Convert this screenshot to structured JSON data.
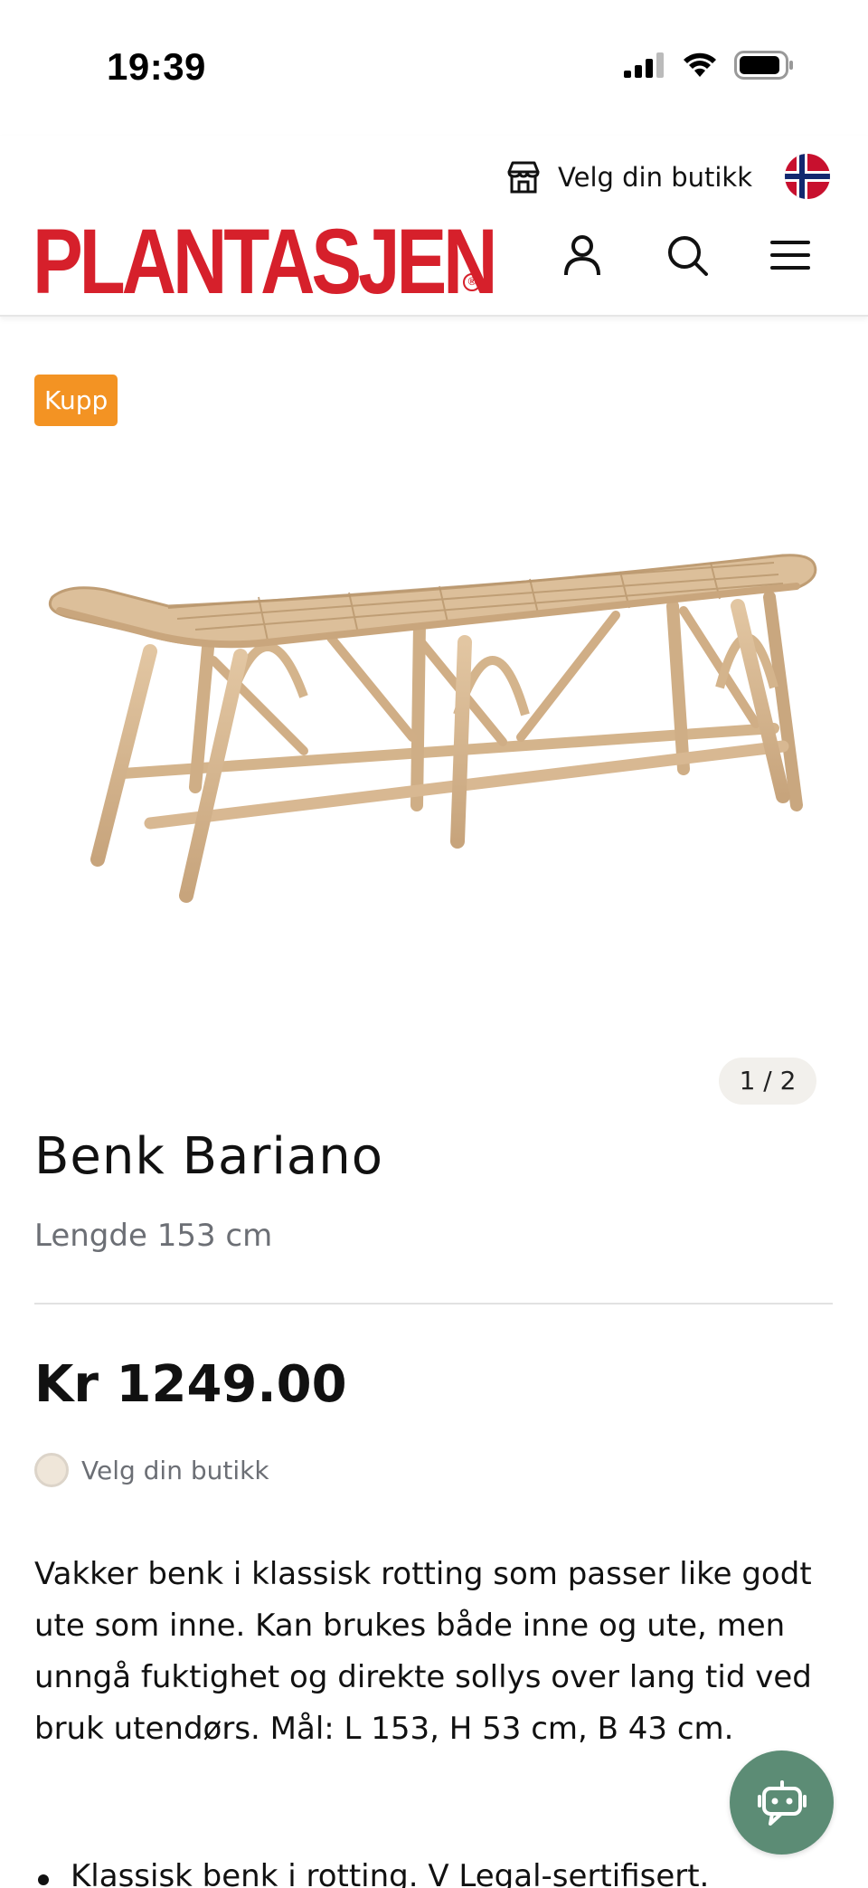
{
  "status_bar": {
    "time": "19:39",
    "icons": [
      "cellular-signal-icon",
      "wifi-icon",
      "battery-icon"
    ]
  },
  "header": {
    "store_link_label": "Velg din butikk",
    "store_icon": "store-icon",
    "flag": "norway-flag-icon",
    "logo_text": "PLANTASJEN",
    "logo_mark": "®",
    "icons": [
      "account-icon",
      "search-icon",
      "menu-icon"
    ],
    "brand_color": "#d6202b"
  },
  "product": {
    "badge": "Kupp",
    "badge_color": "#f39323",
    "image_name": "rattan-bench-image",
    "pager": "1 / 2",
    "title": "Benk Bariano",
    "subtitle": "Lengde 153 cm",
    "price": "Kr 1249.00",
    "store_select_label": "Velg din butikk",
    "description": "Vakker benk i klassisk rotting som passer like godt ute som inne. Kan brukes både inne og ute, men unngå fuktighet og direkte sollys over lang tid ved bruk utendørs. Mål: L 153, H 53 cm, B 43 cm.",
    "bullets": [
      "Klassisk benk i rotting. V Legal-sertifisert."
    ]
  },
  "chat": {
    "icon": "chat-bot-icon",
    "color": "#5c8c75"
  }
}
